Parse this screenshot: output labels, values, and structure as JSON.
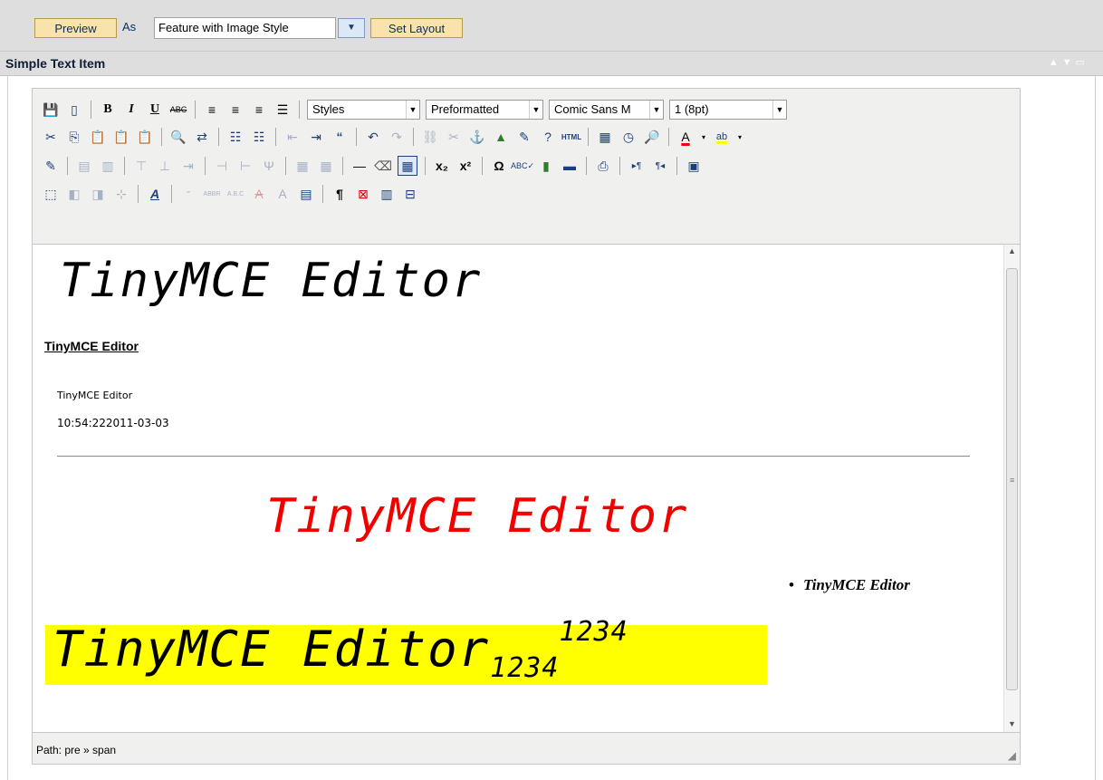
{
  "toolbar": {
    "preview_label": "Preview",
    "as_label": "As",
    "layout_value": "Feature with Image Style",
    "set_layout_label": "Set Layout"
  },
  "section": {
    "title": "Simple Text Item"
  },
  "editor": {
    "styles_dropdown": "Styles",
    "format_dropdown": "Preformatted",
    "font_dropdown": "Comic Sans M",
    "size_dropdown": "1 (8pt)",
    "status_path": "Path: pre » span"
  },
  "content": {
    "heading_large": "TinyMCE Editor",
    "heading_small": "TinyMCE Editor",
    "text_small": "TinyMCE Editor",
    "timestamp": "10:54:222011-03-03",
    "red_text": "TinyMCE Editor",
    "bullet_text": "TinyMCE Editor",
    "highlight_text": "TinyMCE Editor",
    "highlight_subscript": "1234",
    "highlight_superscript": "1234"
  },
  "colors": {
    "button_bg": "#f7e3ab",
    "header_bg": "#dedede",
    "red_text": "#f20000",
    "highlight": "#ffff00"
  }
}
